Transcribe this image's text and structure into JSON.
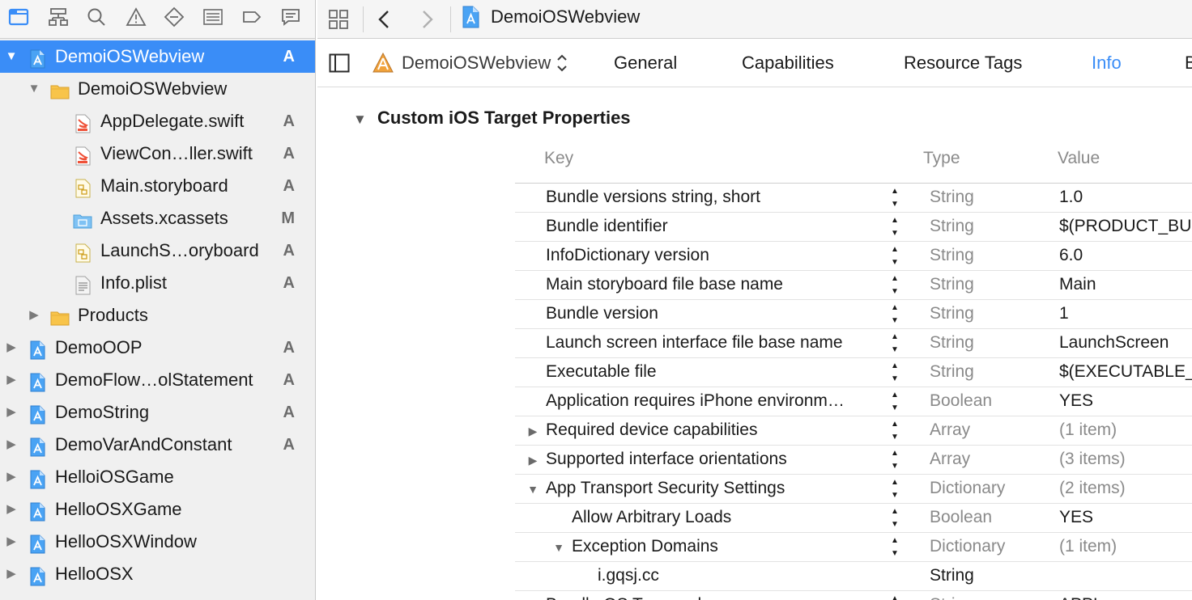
{
  "navigator": {
    "toolbar_icons": [
      "folder-icon",
      "hierarchy-icon",
      "search-icon",
      "warning-icon",
      "test-diamond-icon",
      "debug-list-icon",
      "breakpoint-icon",
      "report-icon"
    ],
    "selected_color": "#3a8df7",
    "tree": [
      {
        "label": "DemoiOSWebview",
        "status": "A",
        "level": 0,
        "disclosure": "open",
        "icon": "xcode-project-icon",
        "selected": true
      },
      {
        "label": "DemoiOSWebview",
        "status": "",
        "level": 1,
        "disclosure": "open",
        "icon": "folder-icon"
      },
      {
        "label": "AppDelegate.swift",
        "status": "A",
        "level": 2,
        "disclosure": "",
        "icon": "swift-file-icon"
      },
      {
        "label": "ViewCon…ller.swift",
        "status": "A",
        "level": 2,
        "disclosure": "",
        "icon": "swift-file-icon"
      },
      {
        "label": "Main.storyboard",
        "status": "A",
        "level": 2,
        "disclosure": "",
        "icon": "storyboard-file-icon"
      },
      {
        "label": "Assets.xcassets",
        "status": "M",
        "level": 2,
        "disclosure": "",
        "icon": "assets-folder-icon"
      },
      {
        "label": "LaunchS…oryboard",
        "status": "A",
        "level": 2,
        "disclosure": "",
        "icon": "storyboard-file-icon"
      },
      {
        "label": "Info.plist",
        "status": "A",
        "level": 2,
        "disclosure": "",
        "icon": "plist-file-icon"
      },
      {
        "label": "Products",
        "status": "",
        "level": 1,
        "disclosure": "closed",
        "icon": "folder-icon"
      },
      {
        "label": "DemoOOP",
        "status": "A",
        "level": 0,
        "disclosure": "closed",
        "icon": "xcode-project-icon"
      },
      {
        "label": "DemoFlow…olStatement",
        "status": "A",
        "level": 0,
        "disclosure": "closed",
        "icon": "xcode-project-icon"
      },
      {
        "label": "DemoString",
        "status": "A",
        "level": 0,
        "disclosure": "closed",
        "icon": "xcode-project-icon"
      },
      {
        "label": "DemoVarAndConstant",
        "status": "A",
        "level": 0,
        "disclosure": "closed",
        "icon": "xcode-project-icon"
      },
      {
        "label": "HelloiOSGame",
        "status": "",
        "level": 0,
        "disclosure": "closed",
        "icon": "xcode-project-icon"
      },
      {
        "label": "HelloOSXGame",
        "status": "",
        "level": 0,
        "disclosure": "closed",
        "icon": "xcode-project-icon"
      },
      {
        "label": "HelloOSXWindow",
        "status": "",
        "level": 0,
        "disclosure": "closed",
        "icon": "xcode-project-icon"
      },
      {
        "label": "HelloOSX",
        "status": "",
        "level": 0,
        "disclosure": "closed",
        "icon": "xcode-project-icon"
      }
    ]
  },
  "jump_bar": {
    "title": "DemoiOSWebview",
    "icons": [
      "grid-icon",
      "back-arrow-icon",
      "forward-arrow-icon",
      "xcode-project-icon"
    ]
  },
  "target_bar": {
    "target_label": "DemoiOSWebview",
    "tabs": [
      {
        "label": "General",
        "active": false
      },
      {
        "label": "Capabilities",
        "active": false
      },
      {
        "label": "Resource Tags",
        "active": false
      },
      {
        "label": "Info",
        "active": true
      },
      {
        "label": "B",
        "active": false
      }
    ]
  },
  "info": {
    "section_title": "Custom iOS Target Properties",
    "columns": {
      "key": "Key",
      "type": "Type",
      "value": "Value"
    },
    "rows": [
      {
        "key": "Bundle versions string, short",
        "type": "String",
        "value": "1.0",
        "level": 0,
        "disclosure": ""
      },
      {
        "key": "Bundle identifier",
        "type": "String",
        "value": "$(PRODUCT_BU",
        "level": 0,
        "disclosure": ""
      },
      {
        "key": "InfoDictionary version",
        "type": "String",
        "value": "6.0",
        "level": 0,
        "disclosure": ""
      },
      {
        "key": "Main storyboard file base name",
        "type": "String",
        "value": "Main",
        "level": 0,
        "disclosure": ""
      },
      {
        "key": "Bundle version",
        "type": "String",
        "value": "1",
        "level": 0,
        "disclosure": ""
      },
      {
        "key": "Launch screen interface file base name",
        "type": "String",
        "value": "LaunchScreen",
        "level": 0,
        "disclosure": ""
      },
      {
        "key": "Executable file",
        "type": "String",
        "value": "$(EXECUTABLE_",
        "level": 0,
        "disclosure": ""
      },
      {
        "key": "Application requires iPhone environm…",
        "type": "Boolean",
        "value": "YES",
        "level": 0,
        "disclosure": ""
      },
      {
        "key": "Required device capabilities",
        "type": "Array",
        "value": "(1 item)",
        "level": 0,
        "disclosure": "closed"
      },
      {
        "key": "Supported interface orientations",
        "type": "Array",
        "value": "(3 items)",
        "level": 0,
        "disclosure": "closed"
      },
      {
        "key": "App Transport Security Settings",
        "type": "Dictionary",
        "value": "(2 items)",
        "level": 0,
        "disclosure": "open"
      },
      {
        "key": "Allow Arbitrary Loads",
        "type": "Boolean",
        "value": "YES",
        "level": 1,
        "disclosure": ""
      },
      {
        "key": "Exception Domains",
        "type": "Dictionary",
        "value": "(1 item)",
        "level": 1,
        "disclosure": "open"
      },
      {
        "key": "i.gqsj.cc",
        "type": "String",
        "value": "",
        "level": 2,
        "disclosure": "",
        "editing": true
      },
      {
        "key": "Bundle OS Type code",
        "type": "String",
        "value": "APPL",
        "level": 0,
        "disclosure": ""
      }
    ]
  }
}
